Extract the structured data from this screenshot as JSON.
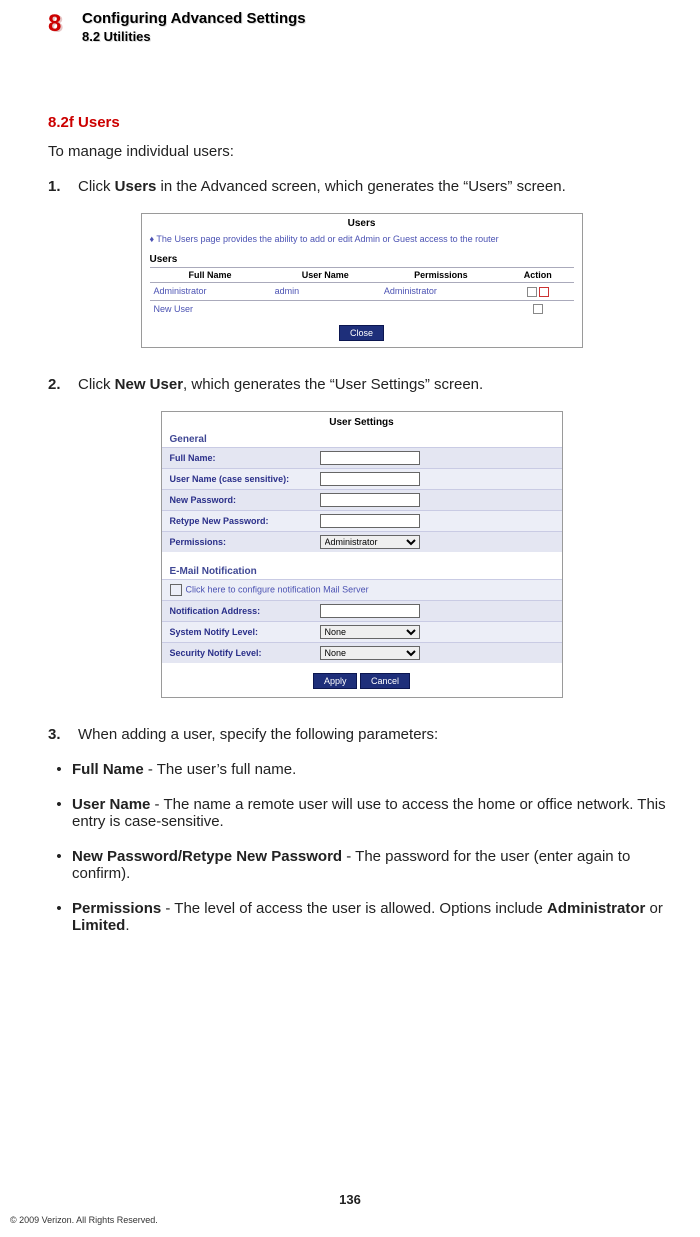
{
  "chapter": {
    "number": "8",
    "title": "Configuring Advanced Settings",
    "subsection": "8.2  Utilities"
  },
  "section_heading": "8.2f  Users",
  "intro": "To manage individual users:",
  "step1": {
    "num": "1.",
    "pre": "Click ",
    "bold": "Users",
    "post": " in the Advanced screen, which generates the “Users” screen."
  },
  "fig1": {
    "title": "Users",
    "hint": "♦  The Users page provides the ability to add or edit Admin or Guest access to the router",
    "sub": "Users",
    "cols": {
      "c1": "Full Name",
      "c2": "User Name",
      "c3": "Permissions",
      "c4": "Action"
    },
    "row1": {
      "fullname": "Administrator",
      "username": "admin",
      "perm": "Administrator"
    },
    "row2": {
      "fullname": "New User"
    },
    "close": "Close"
  },
  "step2": {
    "num": "2.",
    "pre": "Click ",
    "bold": "New User",
    "post": ", which generates the “User Settings” screen."
  },
  "fig2": {
    "title": "User Settings",
    "grp_general": "General",
    "full_name": "Full Name:",
    "user_name": "User Name (case sensitive):",
    "new_pw": "New Password:",
    "retype_pw": "Retype New Password:",
    "permissions": "Permissions:",
    "perm_opt": "Administrator",
    "grp_email": "E-Mail Notification",
    "email_link": "Click here to configure notification Mail Server",
    "notif_addr": "Notification Address:",
    "sys_notify": "System Notify Level:",
    "sec_notify": "Security Notify Level:",
    "none_opt": "None",
    "apply": "Apply",
    "cancel": "Cancel"
  },
  "step3": {
    "num": "3.",
    "text": "When adding a user, specify the following parameters:"
  },
  "bullets": [
    {
      "bold": "Full Name",
      "text": " - The user’s full name."
    },
    {
      "bold": "User Name",
      "text": " - The name a remote user will use to access the home or office network. This entry is case-sensitive."
    },
    {
      "bold": "New Password/Retype New Password",
      "text": " - The password for the user (enter again to confirm)."
    },
    {
      "bold": "Permissions",
      "text": " - The level of access the user is allowed. Options include ",
      "bold2": "Administrator",
      "mid": " or ",
      "bold3": "Limited",
      "post": "."
    }
  ],
  "page_num": "136",
  "copyright": "© 2009 Verizon. All Rights Reserved."
}
